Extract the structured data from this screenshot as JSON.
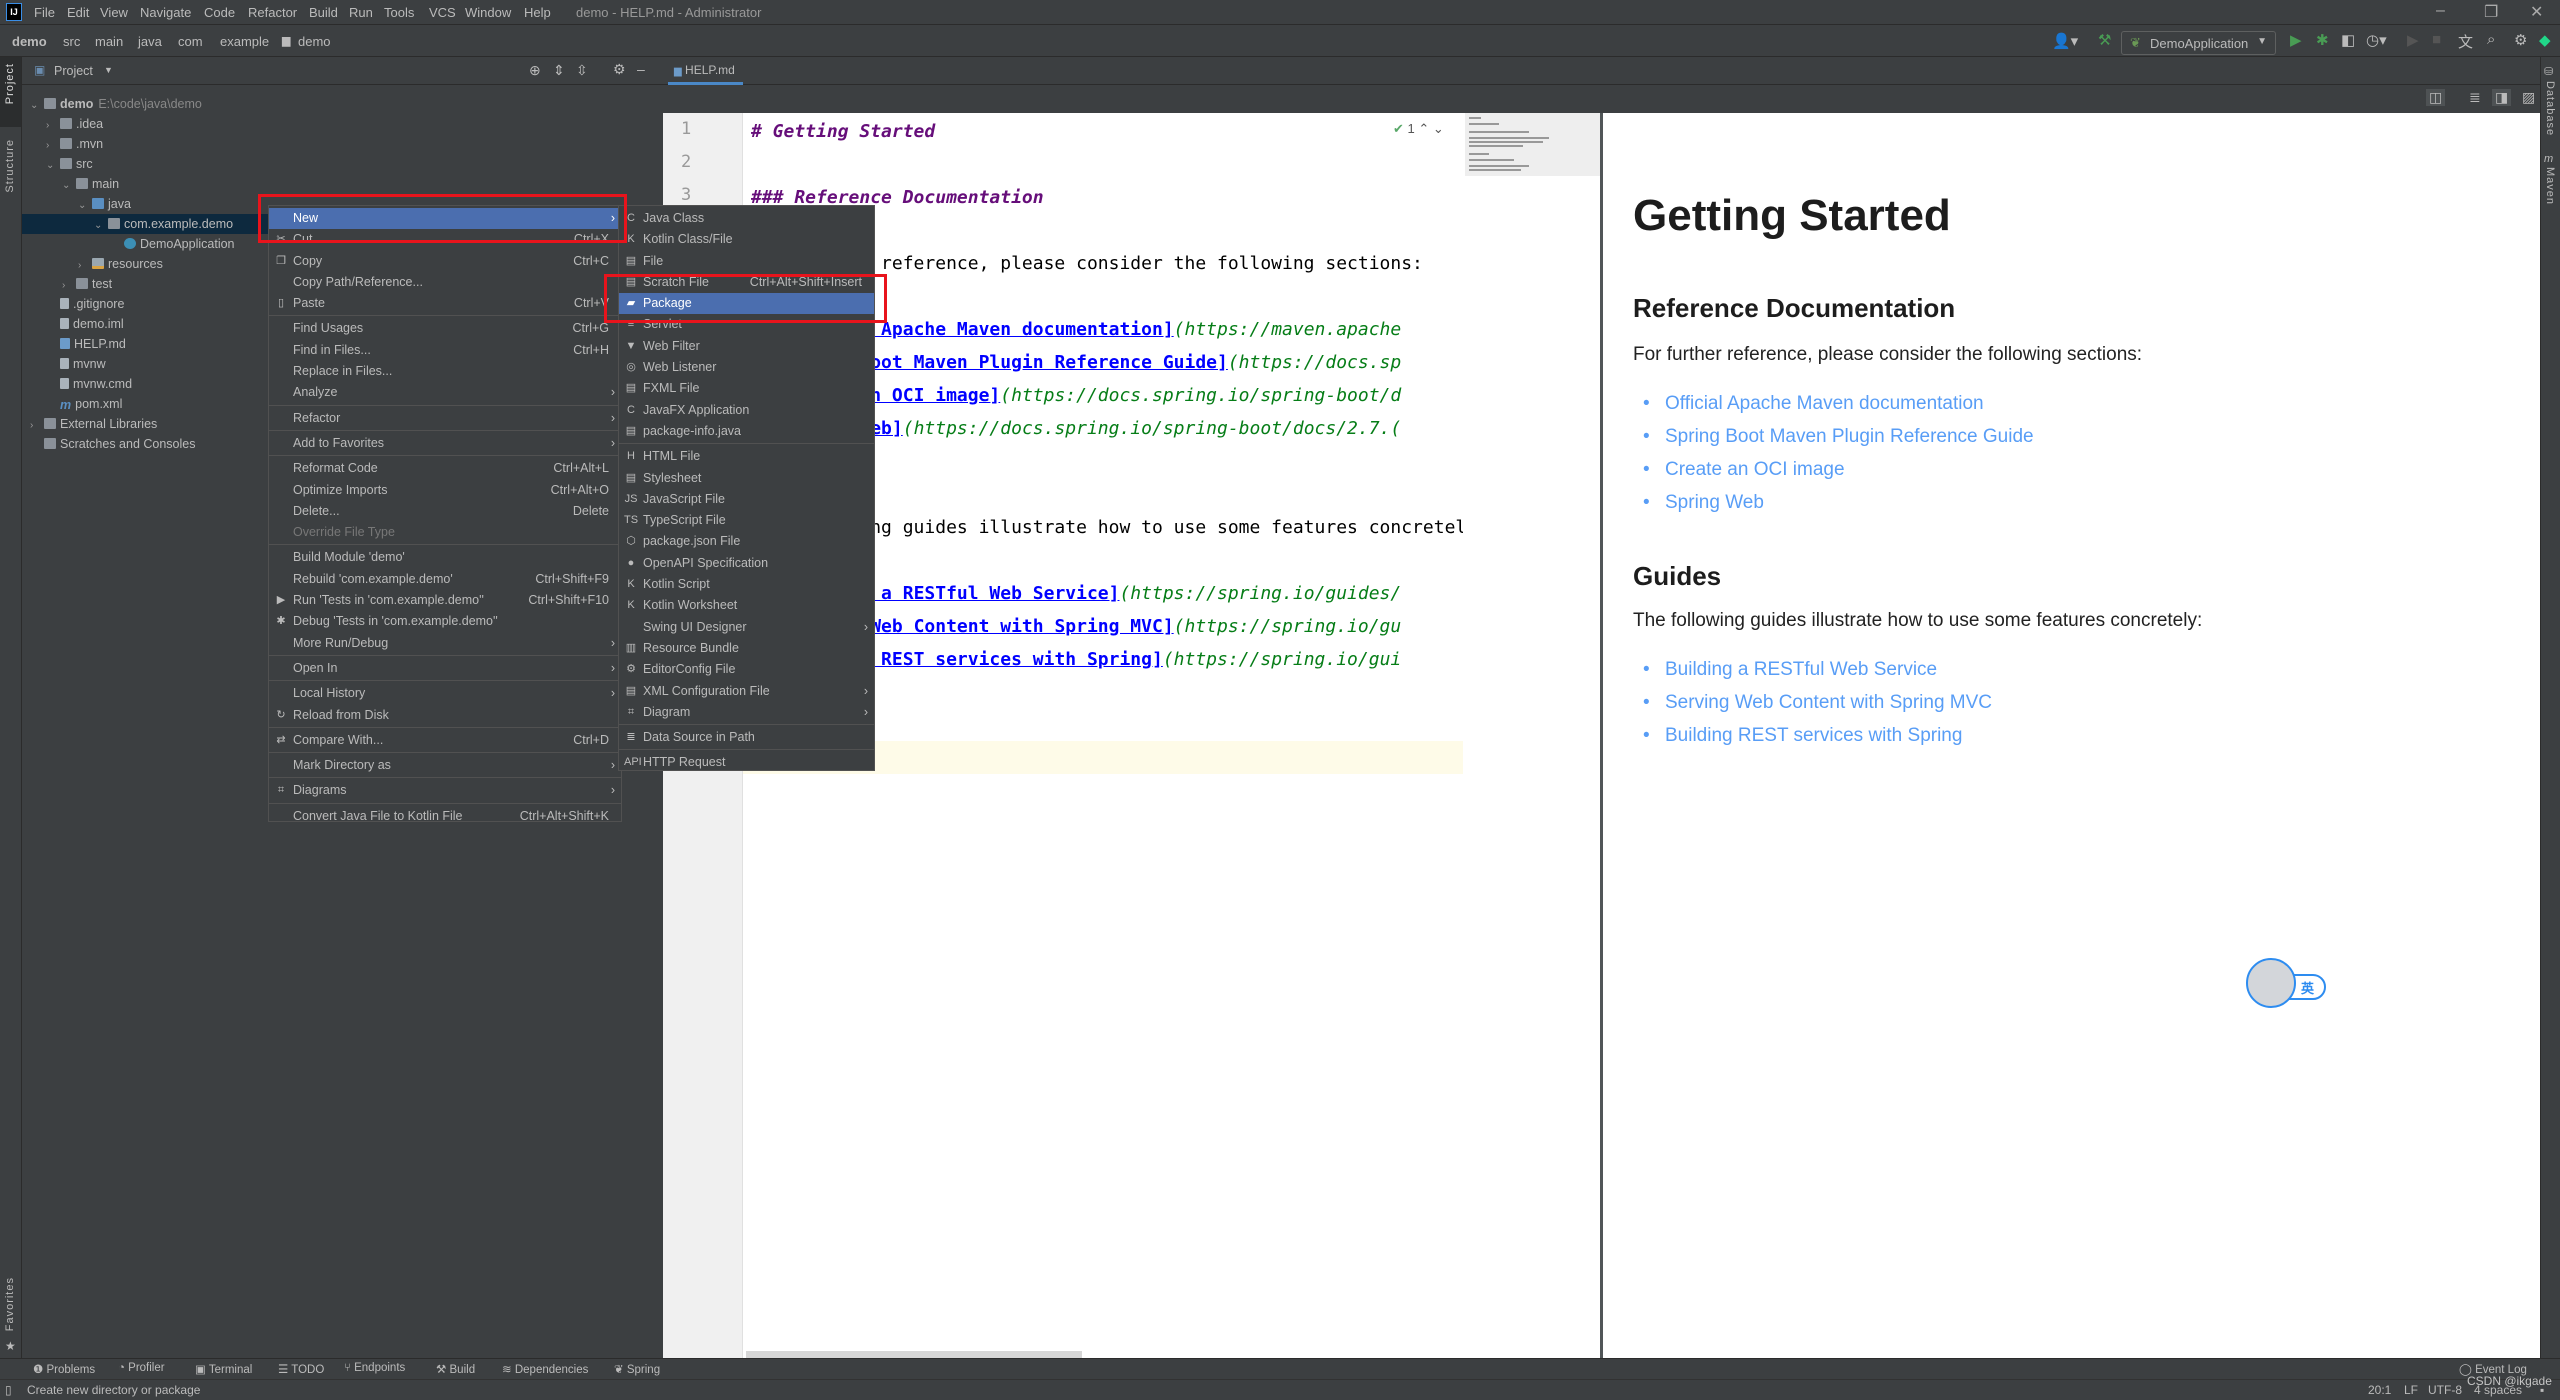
{
  "titlebar": {
    "menu": [
      "File",
      "Edit",
      "View",
      "Navigate",
      "Code",
      "Refactor",
      "Build",
      "Run",
      "Tools",
      "VCS",
      "Window",
      "Help"
    ],
    "title": "demo - HELP.md - Administrator",
    "app_icon": "IJ"
  },
  "breadcrumb": [
    "demo",
    "src",
    "main",
    "java",
    "com",
    "example",
    "demo"
  ],
  "toolbar": {
    "run_config": "DemoApplication",
    "icons": [
      "user-icon",
      "build-hammer-icon",
      "run-icon",
      "debug-icon",
      "coverage-icon",
      "profile-icon",
      "run-disabled-icon",
      "stop-icon",
      "translate-icon",
      "search-icon",
      "gear-icon",
      "toolbox-icon"
    ]
  },
  "left_strip": {
    "project": "Project",
    "structure": "Structure",
    "favorites": "Favorites"
  },
  "right_strip": {
    "database": "Database",
    "maven": "Maven"
  },
  "project_panel": {
    "title": "Project",
    "tree": [
      {
        "label": "demo",
        "path": "E:\\code\\java\\demo",
        "depth": 0,
        "arrow": "open",
        "icon": "module"
      },
      {
        "label": ".idea",
        "depth": 1,
        "arrow": "closed",
        "icon": "folder"
      },
      {
        "label": ".mvn",
        "depth": 1,
        "arrow": "closed",
        "icon": "folder"
      },
      {
        "label": "src",
        "depth": 1,
        "arrow": "open",
        "icon": "folder"
      },
      {
        "label": "main",
        "depth": 2,
        "arrow": "open",
        "icon": "folder"
      },
      {
        "label": "java",
        "depth": 3,
        "arrow": "open",
        "icon": "src"
      },
      {
        "label": "com.example.demo",
        "depth": 4,
        "arrow": "open",
        "icon": "package",
        "selected": true
      },
      {
        "label": "DemoApplication",
        "depth": 5,
        "arrow": "",
        "icon": "java"
      },
      {
        "label": "resources",
        "depth": 3,
        "arrow": "closed",
        "icon": "res"
      },
      {
        "label": "test",
        "depth": 2,
        "arrow": "closed",
        "icon": "folder"
      },
      {
        "label": ".gitignore",
        "depth": 1,
        "arrow": "",
        "icon": "file"
      },
      {
        "label": "demo.iml",
        "depth": 1,
        "arrow": "",
        "icon": "file"
      },
      {
        "label": "HELP.md",
        "depth": 1,
        "arrow": "",
        "icon": "md"
      },
      {
        "label": "mvnw",
        "depth": 1,
        "arrow": "",
        "icon": "file"
      },
      {
        "label": "mvnw.cmd",
        "depth": 1,
        "arrow": "",
        "icon": "file"
      },
      {
        "label": "pom.xml",
        "depth": 1,
        "arrow": "",
        "icon": "m"
      },
      {
        "label": "External Libraries",
        "depth": 0,
        "arrow": "closed",
        "icon": "libs"
      },
      {
        "label": "Scratches and Consoles",
        "depth": 0,
        "arrow": "",
        "icon": "scratch"
      }
    ]
  },
  "editor": {
    "tab": "HELP.md",
    "inspection_count": "1",
    "lines": [
      [
        {
          "c": "heading",
          "t": "# Getting Started"
        }
      ],
      [],
      [
        {
          "c": "heading",
          "t": "### Reference Documentation"
        }
      ],
      [],
      [
        {
          "c": "",
          "t": "For further reference, please consider the following sections:"
        }
      ],
      [],
      [
        {
          "c": "",
          "t": "* "
        },
        {
          "c": "linktext",
          "t": "[Official Apache Maven documentation]"
        },
        {
          "c": "url",
          "t": "(https://maven.apache"
        }
      ],
      [
        {
          "c": "",
          "t": "* "
        },
        {
          "c": "linktext",
          "t": "[Spring Boot Maven Plugin Reference Guide]"
        },
        {
          "c": "url",
          "t": "(https://docs.sp"
        }
      ],
      [
        {
          "c": "",
          "t": "* "
        },
        {
          "c": "linktext",
          "t": "[Create an OCI image]"
        },
        {
          "c": "url",
          "t": "(https://docs.spring.io/spring-boot/d"
        }
      ],
      [
        {
          "c": "",
          "t": "* "
        },
        {
          "c": "linktext",
          "t": "[Spring Web]"
        },
        {
          "c": "url",
          "t": "(https://docs.spring.io/spring-boot/docs/2.7.("
        }
      ],
      [],
      [
        {
          "c": "heading",
          "t": "### Guides"
        }
      ],
      [
        {
          "c": "",
          "t": "The following guides illustrate how to use some features concretely:"
        }
      ],
      [],
      [
        {
          "c": "",
          "t": "* "
        },
        {
          "c": "linktext",
          "t": "[Building a RESTful Web Service]"
        },
        {
          "c": "url",
          "t": "(https://spring.io/guides/"
        }
      ],
      [
        {
          "c": "",
          "t": "* "
        },
        {
          "c": "linktext",
          "t": "[Serving Web Content with Spring MVC]"
        },
        {
          "c": "url",
          "t": "(https://spring.io/gu"
        }
      ],
      [
        {
          "c": "",
          "t": "* "
        },
        {
          "c": "linktext",
          "t": "[Building REST services with Spring]"
        },
        {
          "c": "url",
          "t": "(https://spring.io/gui"
        }
      ],
      [],
      [],
      []
    ]
  },
  "preview": {
    "h1": "Getting Started",
    "ref_heading": "Reference Documentation",
    "ref_intro": "For further reference, please consider the following sections:",
    "ref_links": [
      "Official Apache Maven documentation",
      "Spring Boot Maven Plugin Reference Guide",
      "Create an OCI image",
      "Spring Web"
    ],
    "guides_heading": "Guides",
    "guides_intro": "The following guides illustrate how to use some features concretely:",
    "guide_links": [
      "Building a RESTful Web Service",
      "Serving Web Content with Spring MVC",
      "Building REST services with Spring"
    ],
    "link_color": "#589df6"
  },
  "context_menu": [
    {
      "label": "New",
      "submenu": true,
      "highlighted": true
    },
    {
      "label": "Cut",
      "shortcut": "Ctrl+X",
      "icon": "✂"
    },
    {
      "label": "Copy",
      "shortcut": "Ctrl+C",
      "icon": "❐"
    },
    {
      "label": "Copy Path/Reference..."
    },
    {
      "label": "Paste",
      "shortcut": "Ctrl+V",
      "icon": "▯"
    },
    {
      "label": "Find Usages",
      "shortcut": "Ctrl+G",
      "sep": true
    },
    {
      "label": "Find in Files...",
      "shortcut": "Ctrl+H"
    },
    {
      "label": "Replace in Files..."
    },
    {
      "label": "Analyze",
      "submenu": true
    },
    {
      "label": "Refactor",
      "submenu": true,
      "sep": true
    },
    {
      "label": "Add to Favorites",
      "submenu": true,
      "sep": true
    },
    {
      "label": "Reformat Code",
      "shortcut": "Ctrl+Alt+L",
      "sep": true
    },
    {
      "label": "Optimize Imports",
      "shortcut": "Ctrl+Alt+O"
    },
    {
      "label": "Delete...",
      "shortcut": "Delete"
    },
    {
      "label": "Override File Type",
      "disabled": true
    },
    {
      "label": "Build Module 'demo'",
      "sep": true
    },
    {
      "label": "Rebuild 'com.example.demo'",
      "shortcut": "Ctrl+Shift+F9"
    },
    {
      "label": "Run 'Tests in 'com.example.demo''",
      "shortcut": "Ctrl+Shift+F10",
      "icon": "▶"
    },
    {
      "label": "Debug 'Tests in 'com.example.demo''",
      "icon": "✱"
    },
    {
      "label": "More Run/Debug",
      "submenu": true
    },
    {
      "label": "Open In",
      "submenu": true,
      "sep": true
    },
    {
      "label": "Local History",
      "submenu": true,
      "sep": true
    },
    {
      "label": "Reload from Disk",
      "icon": "↻"
    },
    {
      "label": "Compare With...",
      "shortcut": "Ctrl+D",
      "icon": "⇄",
      "sep": true
    },
    {
      "label": "Mark Directory as",
      "submenu": true,
      "sep": true
    },
    {
      "label": "Diagrams",
      "submenu": true,
      "icon": "⌗",
      "sep": true
    },
    {
      "label": "Convert Java File to Kotlin File",
      "shortcut": "Ctrl+Alt+Shift+K",
      "sep": true
    }
  ],
  "new_submenu": [
    {
      "label": "Java Class",
      "icon": "C"
    },
    {
      "label": "Kotlin Class/File",
      "icon": "K"
    },
    {
      "label": "File",
      "icon": "▤"
    },
    {
      "label": "Scratch File",
      "shortcut": "Ctrl+Alt+Shift+Insert",
      "icon": "▤"
    },
    {
      "label": "Package",
      "icon": "▰",
      "highlighted": true
    },
    {
      "label": "Servlet",
      "icon": "≡"
    },
    {
      "label": "Web Filter",
      "icon": "▼"
    },
    {
      "label": "Web Listener",
      "icon": "◎"
    },
    {
      "label": "FXML File",
      "icon": "▤"
    },
    {
      "label": "JavaFX Application",
      "icon": "C"
    },
    {
      "label": "package-info.java",
      "icon": "▤"
    },
    {
      "label": "HTML File",
      "icon": "H",
      "sep": true
    },
    {
      "label": "Stylesheet",
      "icon": "▤"
    },
    {
      "label": "JavaScript File",
      "icon": "JS"
    },
    {
      "label": "TypeScript File",
      "icon": "TS"
    },
    {
      "label": "package.json File",
      "icon": "⬡"
    },
    {
      "label": "OpenAPI Specification",
      "icon": "●"
    },
    {
      "label": "Kotlin Script",
      "icon": "K"
    },
    {
      "label": "Kotlin Worksheet",
      "icon": "K"
    },
    {
      "label": "Swing UI Designer",
      "submenu": true
    },
    {
      "label": "Resource Bundle",
      "icon": "▥"
    },
    {
      "label": "EditorConfig File",
      "icon": "⚙"
    },
    {
      "label": "XML Configuration File",
      "icon": "▤",
      "submenu": true
    },
    {
      "label": "Diagram",
      "icon": "⌗",
      "submenu": true
    },
    {
      "label": "Data Source in Path",
      "icon": "≣",
      "sep": true
    },
    {
      "label": "HTTP Request",
      "icon": "API",
      "sep": true
    }
  ],
  "bottom_tools": [
    "Problems",
    "Profiler",
    "Terminal",
    "TODO",
    "Endpoints",
    "Build",
    "Dependencies",
    "Spring"
  ],
  "status": {
    "message": "Create new directory or package",
    "event_log": "Event Log",
    "position": "20:1",
    "line_sep": "LF",
    "encoding": "UTF-8",
    "indent": "4 spaces",
    "watermark": "CSDN @ikgade"
  },
  "ime": {
    "mode": "英"
  },
  "colors": {
    "highlight": "#4b6eaf",
    "annotation": "#e8141c",
    "selected_row": "#0d293e"
  }
}
